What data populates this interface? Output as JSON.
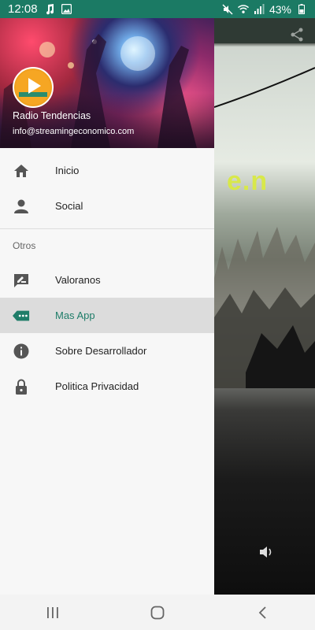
{
  "status_bar": {
    "time": "12:08",
    "battery": "43%",
    "icons": [
      "music-note-icon",
      "image-icon",
      "mute-icon",
      "wifi-icon",
      "signal-icon",
      "battery-icon"
    ]
  },
  "drawer": {
    "header": {
      "title": "Radio Tendencias",
      "email": "info@streamingeconomico.com"
    },
    "primary_items": [
      {
        "label": "Inicio",
        "icon": "home-icon"
      },
      {
        "label": "Social",
        "icon": "person-icon"
      }
    ],
    "section_title": "Otros",
    "secondary_items": [
      {
        "label": "Valoranos",
        "icon": "rate-review-icon"
      },
      {
        "label": "Mas App",
        "icon": "more-apps-icon",
        "active": true
      },
      {
        "label": "Sobre Desarrollador",
        "icon": "info-icon"
      },
      {
        "label": "Politica Privacidad",
        "icon": "lock-icon"
      }
    ]
  },
  "background": {
    "text_fragment": "e.n"
  },
  "colors": {
    "accent": "#1f7d69",
    "status_bar": "#1b7a64",
    "active_row": "#dcdcdc",
    "icon_gray": "#555555"
  }
}
